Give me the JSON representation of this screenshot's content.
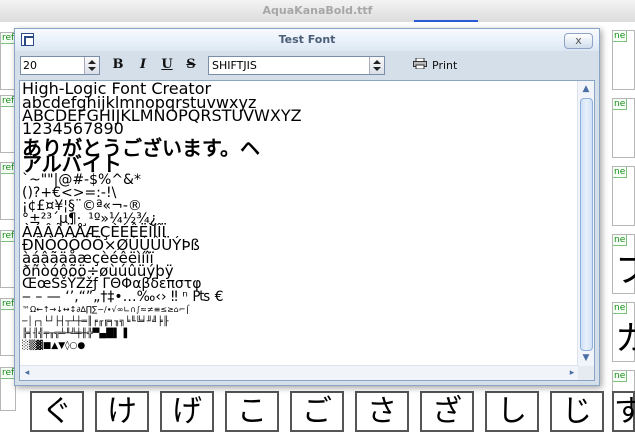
{
  "background_window": {
    "title": "AquaKanaBold.ttf",
    "cell_ref_label": "ref",
    "cell_ref_label_alt": "ne",
    "right_glyphs": [
      "フ",
      "カ"
    ],
    "bottom_glyphs": [
      "ぐ",
      "け",
      "げ",
      "こ",
      "ご",
      "さ",
      "ざ",
      "し",
      "じ",
      "す"
    ]
  },
  "dialog": {
    "title": "Test Font",
    "close_label": "x",
    "toolbar": {
      "font_size": "20",
      "bold_label": "B",
      "italic_label": "I",
      "underline_label": "U",
      "strike_label": "S",
      "encoding": "SHIFTJIS",
      "print_label": "Print"
    },
    "preview_lines": [
      "High-Logic  Font  Creator",
      "abcdefghijklmnopqrstuvwxyz",
      "ABCDEFGHIJKLMNOPQRSTUVWXYZ",
      "1234567890",
      "ありがとうございます。ヘ",
      "アルバイト",
      "`~\"\"|@#-$%^&*",
      "()?+€<>=:-!\\",
      "¡¢£¤¥¦§¨©ª«¬-®",
      "°±²³´µ¶·¸¹º»¼½¾¿",
      "ÀÁÂÃÄÅÆÇÈÉÊËÌÍÎÏ",
      "ÐÑÒÓÔÕÖ×ØÙÚÛÜÝÞß",
      "àáâãäåæçèéêëìíîï",
      "ðñòóôõö÷øùúûüýþÿ",
      "ŒœŠšŸŽžƒ  ΓΘΦαβδεπστφ",
      "‒  –  —  ‘’‚“”„†‡•…‰‹›  ‼  ⁿ  ₧  €",
      "™Ω←↑→↓↔↕∂∆∏∑−∕∙√∞∟∩∫≈≠≡≤≥⌂⌐⌠",
      "─│┌┐└┘├┤┬┴┼═║╒╓╔╕╖╗╘╙╚╛╜╝╞╟",
      "╠╡╢╣╤╥╦╧╨╩╪╫╬▀▄█▌▐",
      "░▒▓■▲▼◊○●"
    ]
  },
  "colors": {
    "dialog_bg": "#d4dfea",
    "scroll_thumb": "#cfe0f7",
    "ref_green": "#1a8a1a"
  }
}
